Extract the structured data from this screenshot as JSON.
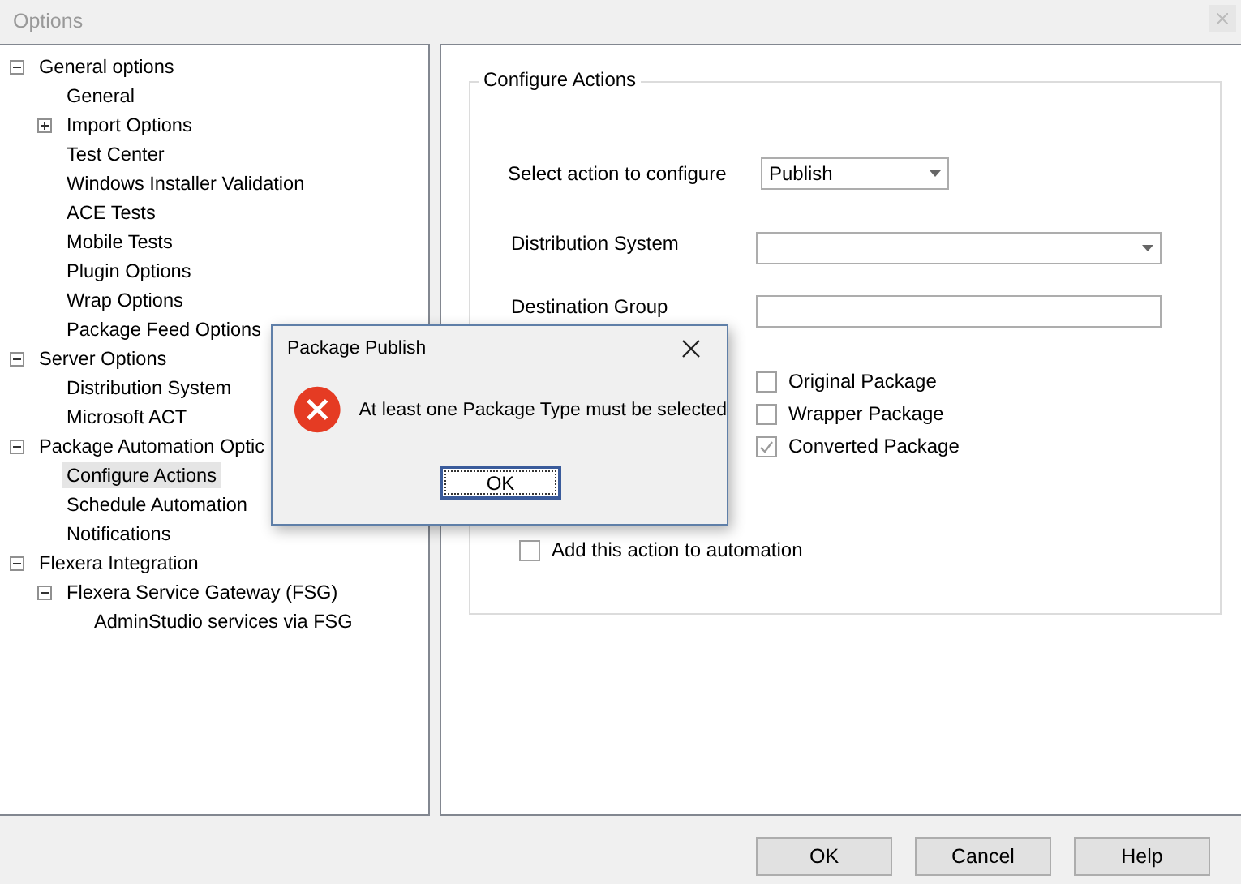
{
  "window": {
    "title": "Options"
  },
  "tree": [
    {
      "label": "General options",
      "expanded": true,
      "selected": false,
      "children": [
        {
          "label": "General",
          "selected": false
        },
        {
          "label": "Import Options",
          "expanded": false,
          "selected": false
        },
        {
          "label": "Test Center",
          "selected": false
        },
        {
          "label": "Windows Installer Validation",
          "selected": false
        },
        {
          "label": "ACE Tests",
          "selected": false
        },
        {
          "label": "Mobile Tests",
          "selected": false
        },
        {
          "label": "Plugin Options",
          "selected": false
        },
        {
          "label": "Wrap Options",
          "selected": false
        },
        {
          "label": "Package Feed Options",
          "selected": false
        }
      ]
    },
    {
      "label": "Server Options",
      "expanded": true,
      "selected": false,
      "children": [
        {
          "label": "Distribution System",
          "selected": false
        },
        {
          "label": "Microsoft ACT",
          "selected": false
        }
      ]
    },
    {
      "label": "Package Automation Optic",
      "expanded": true,
      "selected": false,
      "children": [
        {
          "label": "Configure Actions",
          "selected": true
        },
        {
          "label": "Schedule Automation",
          "selected": false
        },
        {
          "label": "Notifications",
          "selected": false
        }
      ]
    },
    {
      "label": "Flexera Integration",
      "expanded": true,
      "selected": false,
      "children": [
        {
          "label": "Flexera Service Gateway (FSG)",
          "expanded": true,
          "selected": false,
          "children": [
            {
              "label": "AdminStudio services via FSG",
              "selected": false
            }
          ]
        }
      ]
    }
  ],
  "group": {
    "title": "Configure Actions",
    "action": {
      "label": "Select action to configure",
      "value": "Publish"
    },
    "distribution": {
      "label": "Distribution System"
    },
    "destination": {
      "label": "Destination Group"
    },
    "package_types": [
      {
        "label": "Original Package",
        "checked": false
      },
      {
        "label": "Wrapper Package",
        "checked": false
      },
      {
        "label": "Converted Package",
        "checked": true
      }
    ],
    "add_to_automation": {
      "label": "Add this action to automation",
      "checked": false
    }
  },
  "buttons": [
    "OK",
    "Cancel",
    "Help"
  ],
  "dialog": {
    "title": "Package Publish",
    "message": "At least one Package Type must be selected",
    "button": "OK"
  }
}
